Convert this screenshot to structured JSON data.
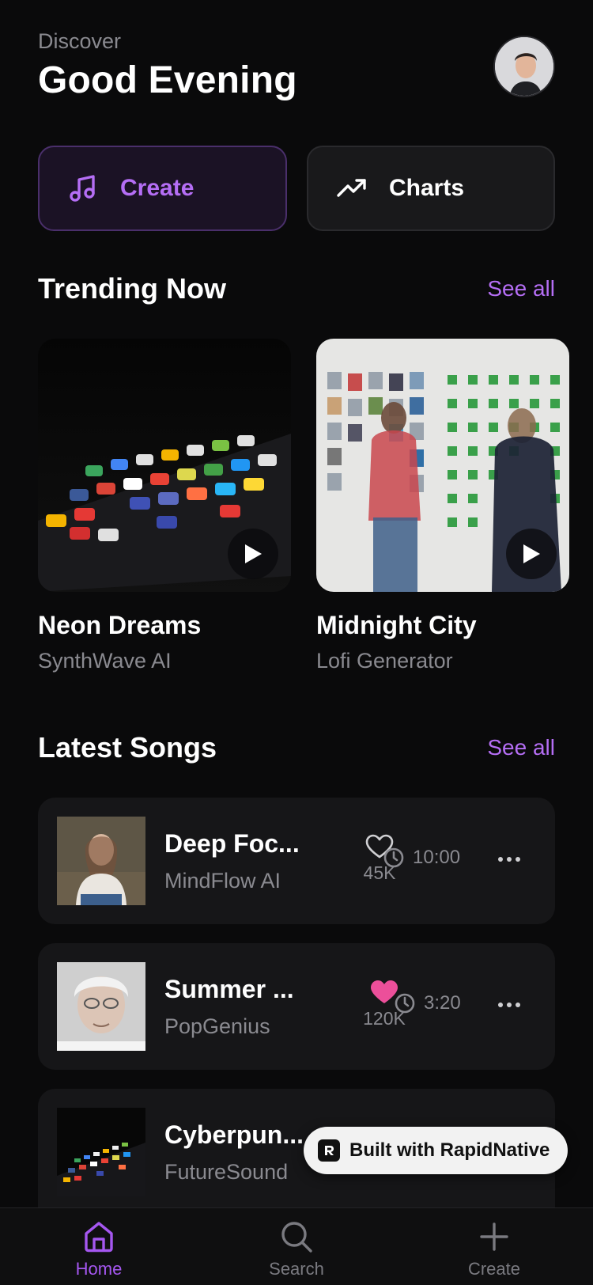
{
  "header": {
    "eyebrow": "Discover",
    "title": "Good Evening"
  },
  "profile": {
    "avatar_icon": "user-avatar"
  },
  "quick_actions": [
    {
      "label": "Create",
      "icon": "music-note-icon",
      "accent": "#b56ef5"
    },
    {
      "label": "Charts",
      "icon": "trending-up-icon"
    }
  ],
  "trending": {
    "heading": "Trending Now",
    "see_all": "See all",
    "items": [
      {
        "title": "Neon Dreams",
        "artist": "SynthWave AI"
      },
      {
        "title": "Midnight City",
        "artist": "Lofi Generator"
      }
    ]
  },
  "latest": {
    "heading": "Latest Songs",
    "see_all": "See all",
    "items": [
      {
        "title": "Deep Foc...",
        "artist": "MindFlow AI",
        "likes": "45K",
        "liked": false,
        "duration": "10:00"
      },
      {
        "title": "Summer ...",
        "artist": "PopGenius",
        "likes": "120K",
        "liked": true,
        "duration": "3:20"
      },
      {
        "title": "Cyberpun...",
        "artist": "FutureSound",
        "likes": "",
        "liked": false,
        "duration": ""
      }
    ]
  },
  "badge": {
    "label": "Built with RapidNative"
  },
  "tabbar": {
    "items": [
      {
        "label": "Home",
        "icon": "home-icon",
        "active": true
      },
      {
        "label": "Search",
        "icon": "search-icon",
        "active": false
      },
      {
        "label": "Create",
        "icon": "plus-icon",
        "active": false
      }
    ]
  },
  "colors": {
    "accent": "#b56ef5",
    "liked": "#ec4f9a",
    "background": "#0a0a0b"
  }
}
